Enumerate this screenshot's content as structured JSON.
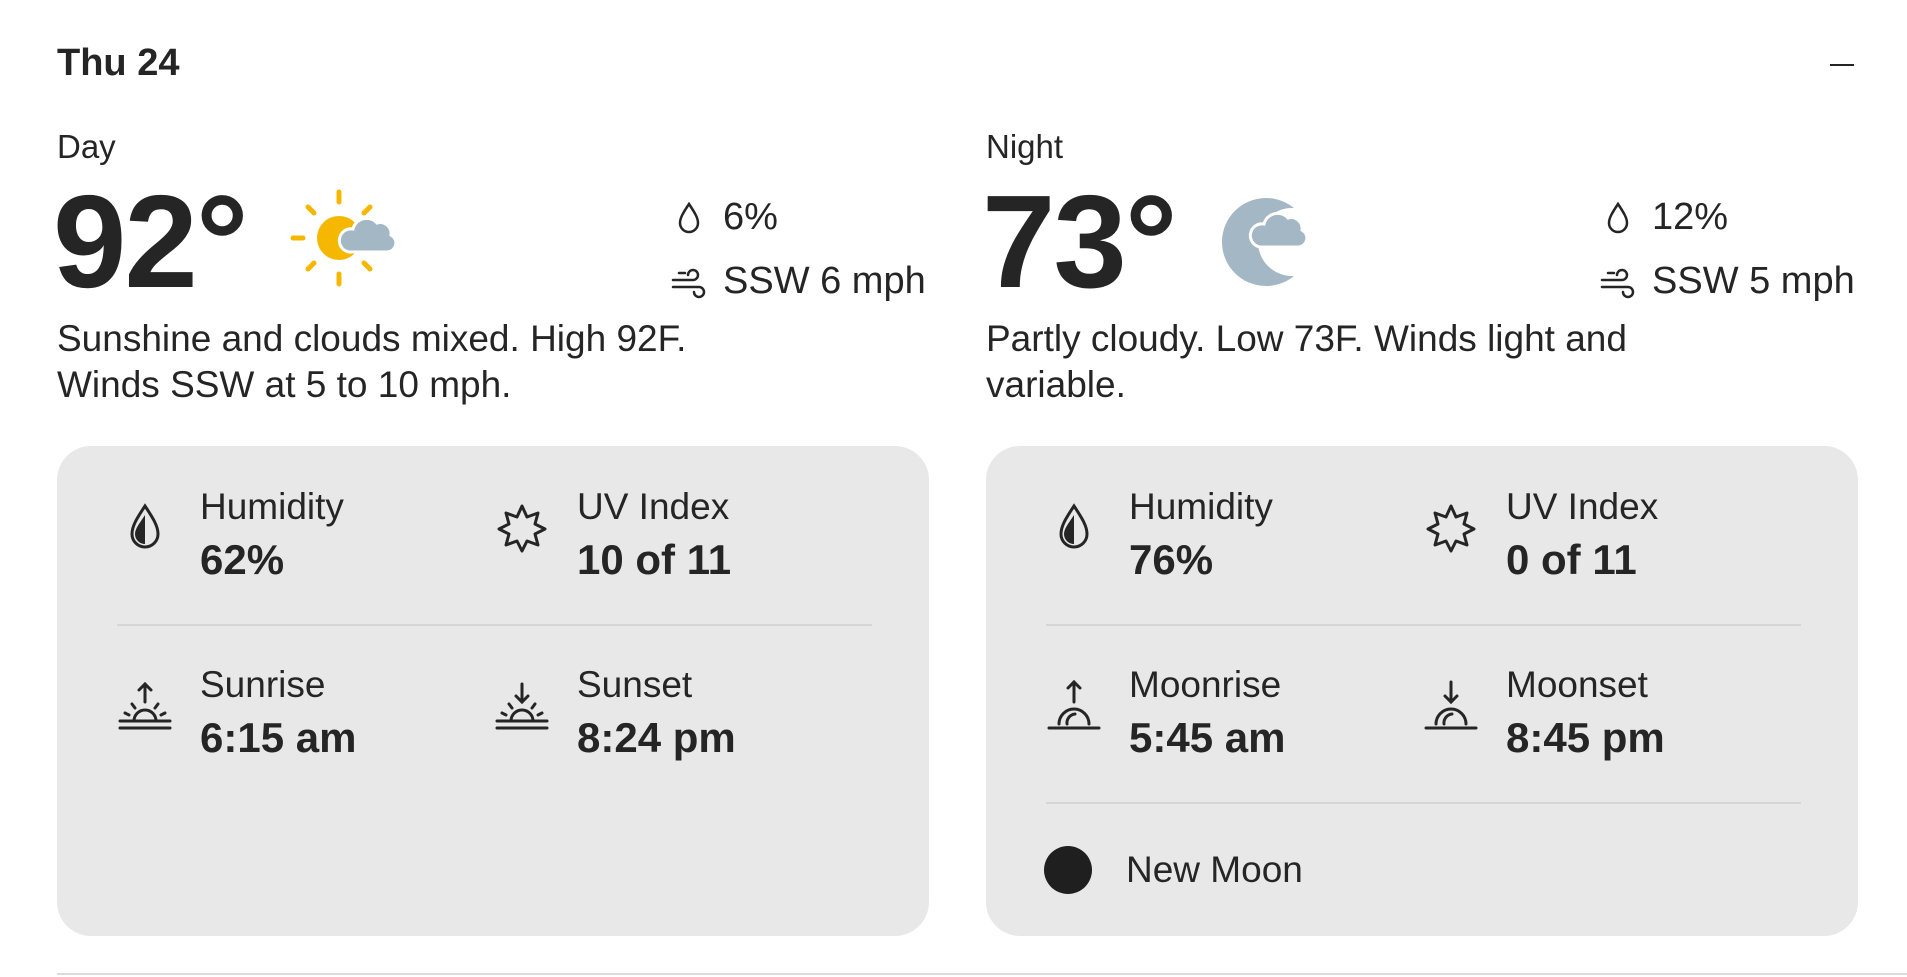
{
  "header": {
    "date": "Thu 24"
  },
  "colors": {
    "sun": "#F5B700",
    "cloud": "#A4B7C4",
    "card": "#E8E8E8",
    "text": "#252525"
  },
  "day": {
    "label": "Day",
    "temperature": "92°",
    "icon": "partly-sunny-icon",
    "precip": "6%",
    "wind": "SSW 6 mph",
    "narrative": "Sunshine and clouds mixed. High 92F. Winds SSW at 5 to 10 mph.",
    "details": {
      "humidity_label": "Humidity",
      "humidity_value": "62%",
      "uv_label": "UV Index",
      "uv_value": "10 of 11",
      "rise_label": "Sunrise",
      "rise_value": "6:15 am",
      "set_label": "Sunset",
      "set_value": "8:24 pm"
    }
  },
  "night": {
    "label": "Night",
    "temperature": "73°",
    "icon": "partly-cloudy-night-icon",
    "precip": "12%",
    "wind": "SSW 5 mph",
    "narrative": "Partly cloudy. Low 73F. Winds light and variable.",
    "details": {
      "humidity_label": "Humidity",
      "humidity_value": "76%",
      "uv_label": "UV Index",
      "uv_value": "0 of 11",
      "rise_label": "Moonrise",
      "rise_value": "5:45 am",
      "set_label": "Moonset",
      "set_value": "8:45 pm",
      "moon_phase": "New Moon"
    }
  }
}
